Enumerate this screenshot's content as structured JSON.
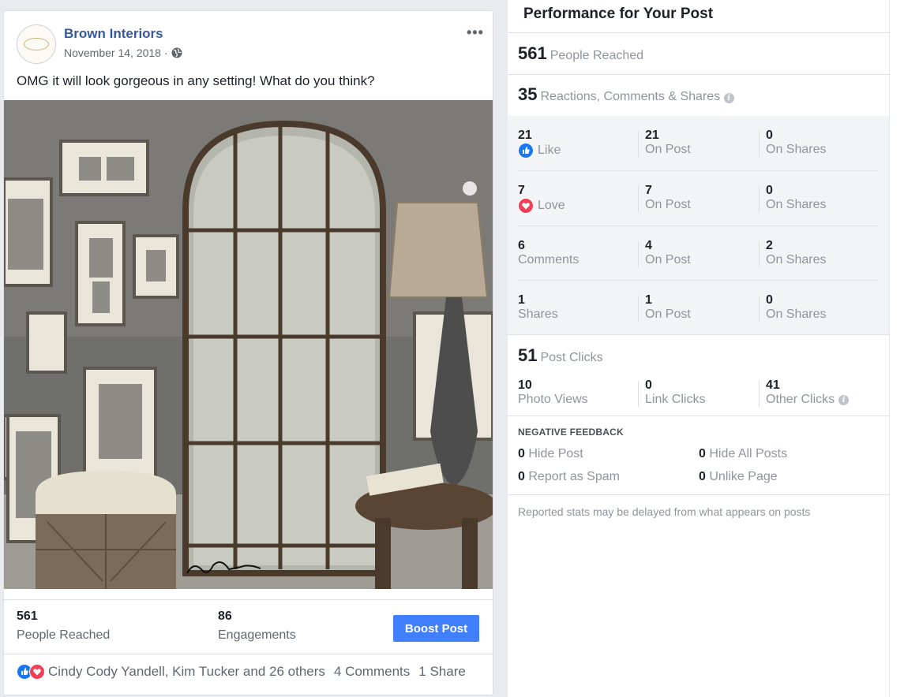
{
  "post": {
    "page_name": "Brown Interiors",
    "date": "November 14, 2018",
    "date_sep": "·",
    "privacy_icon": "globe-icon",
    "more_label": "•••",
    "text": "OMG it will look gorgeous in any setting! What do you think?",
    "photo_signature_alt": "Grace Feyock signature",
    "stats": {
      "reached_value": "561",
      "reached_label": "People Reached",
      "engagements_value": "86",
      "engagements_label": "Engagements"
    },
    "boost_label": "Boost Post",
    "reactions_text": "Cindy Cody Yandell, Kim Tucker and 26 others",
    "comments_text": "4 Comments",
    "shares_text": "1 Share"
  },
  "panel": {
    "title": "Performance for Your Post",
    "reached": {
      "value": "561",
      "label": "People Reached"
    },
    "reactions": {
      "value": "35",
      "label": "Reactions, Comments & Shares"
    },
    "breakdown": [
      {
        "total": "21",
        "label": "Like",
        "icon": "like-icon",
        "on_post": "21",
        "on_post_label": "On Post",
        "on_shares": "0",
        "on_shares_label": "On Shares"
      },
      {
        "total": "7",
        "label": "Love",
        "icon": "love-icon",
        "on_post": "7",
        "on_post_label": "On Post",
        "on_shares": "0",
        "on_shares_label": "On Shares"
      },
      {
        "total": "6",
        "label": "Comments",
        "icon": "",
        "on_post": "4",
        "on_post_label": "On Post",
        "on_shares": "2",
        "on_shares_label": "On Shares"
      },
      {
        "total": "1",
        "label": "Shares",
        "icon": "",
        "on_post": "1",
        "on_post_label": "On Post",
        "on_shares": "0",
        "on_shares_label": "On Shares"
      }
    ],
    "clicks": {
      "value": "51",
      "label": "Post Clicks",
      "photo_views": "10",
      "photo_views_label": "Photo Views",
      "link_clicks": "0",
      "link_clicks_label": "Link Clicks",
      "other_clicks": "41",
      "other_clicks_label": "Other Clicks"
    },
    "negative": {
      "title": "NEGATIVE FEEDBACK",
      "hide_post": "0",
      "hide_post_label": "Hide Post",
      "hide_all": "0",
      "hide_all_label": "Hide All Posts",
      "spam": "0",
      "spam_label": "Report as Spam",
      "unlike": "0",
      "unlike_label": "Unlike Page"
    },
    "footnote": "Reported stats may be delayed from what appears on posts"
  },
  "colors": {
    "link": "#365899",
    "button": "#4080ff",
    "like": "#1877f2",
    "love": "#f33e58"
  }
}
